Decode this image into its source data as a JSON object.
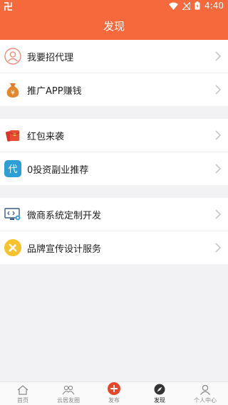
{
  "status": {
    "time": "4:40",
    "carrier": "卍"
  },
  "header": {
    "title": "发现"
  },
  "groups": [
    {
      "items": [
        {
          "label": "我要招代理",
          "icon": "person-circle-icon"
        },
        {
          "label": "推广APP赚钱",
          "icon": "money-bag-icon"
        }
      ]
    },
    {
      "items": [
        {
          "label": "红包来袭",
          "icon": "red-envelope-icon"
        },
        {
          "label": "0投资副业推荐",
          "icon": "dai-badge-icon"
        }
      ]
    },
    {
      "items": [
        {
          "label": "微商系统定制开发",
          "icon": "computer-code-icon"
        },
        {
          "label": "品牌宣传设计服务",
          "icon": "design-tools-icon"
        }
      ]
    }
  ],
  "tabbar": [
    {
      "label": "首页",
      "icon": "home-icon"
    },
    {
      "label": "云居友圈",
      "icon": "friends-icon"
    },
    {
      "label": "发布",
      "icon": "plus-circle-icon"
    },
    {
      "label": "发现",
      "icon": "compass-icon"
    },
    {
      "label": "个人中心",
      "icon": "user-icon"
    }
  ],
  "colors": {
    "accent": "#f5693c",
    "publish": "#e8452a"
  },
  "badge_text": "代"
}
